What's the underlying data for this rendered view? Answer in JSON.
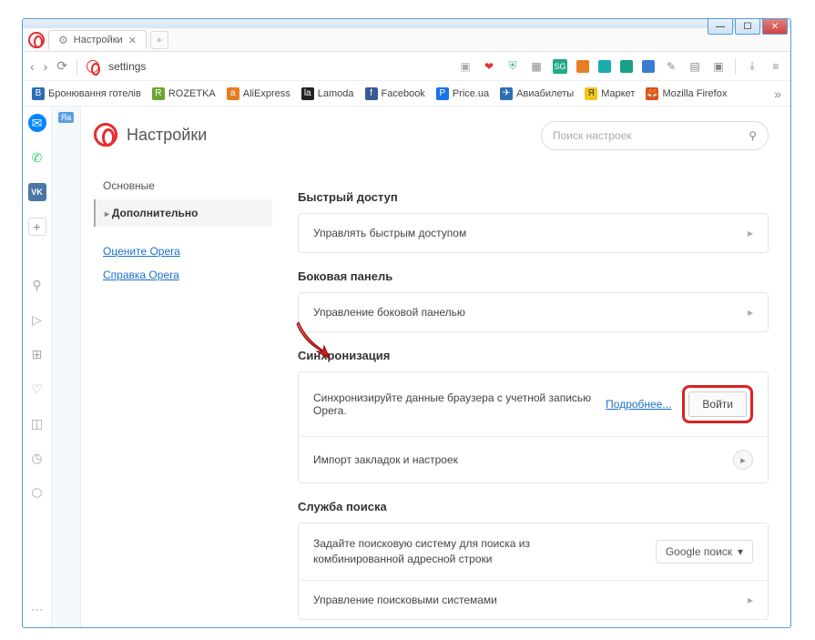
{
  "tab": {
    "title": "Настройки"
  },
  "addressbar": {
    "url": "settings"
  },
  "bookmarks": [
    {
      "icon": "bm-blue",
      "label": "Бронювання готелів"
    },
    {
      "icon": "bm-green",
      "label": "ROZETKA"
    },
    {
      "icon": "bm-orange",
      "label": "AliExpress"
    },
    {
      "icon": "bm-black",
      "label": "Lamoda"
    },
    {
      "icon": "bm-fb",
      "label": "Facebook"
    },
    {
      "icon": "bm-pu",
      "label": "Price.ua"
    },
    {
      "icon": "bm-blue",
      "label": "Авиабилеты"
    },
    {
      "icon": "bm-y",
      "label": "Маркет"
    },
    {
      "icon": "bm-ff",
      "label": "Mozilla Firefox"
    }
  ],
  "settings_page": {
    "title": "Настройки",
    "search_placeholder": "Поиск настроек",
    "nav_basic": "Основные",
    "nav_advanced": "Дополнительно",
    "link_rate": "Оцените Opera",
    "link_help": "Справка Opera"
  },
  "sections": {
    "quick_access": {
      "title": "Быстрый доступ",
      "manage": "Управлять быстрым доступом"
    },
    "side_panel": {
      "title": "Боковая панель",
      "manage": "Управление боковой панелью"
    },
    "sync": {
      "title": "Синхронизация",
      "desc": "Синхронизируйте данные браузера с учетной записью Opera.",
      "learn_more": "Подробнее...",
      "login": "Войти",
      "import": "Импорт закладок и настроек"
    },
    "search": {
      "title": "Служба поиска",
      "desc": "Задайте поисковую систему для поиска из комбинированной адресной строки",
      "engine": "Google поиск",
      "manage": "Управление поисковыми системами"
    }
  }
}
